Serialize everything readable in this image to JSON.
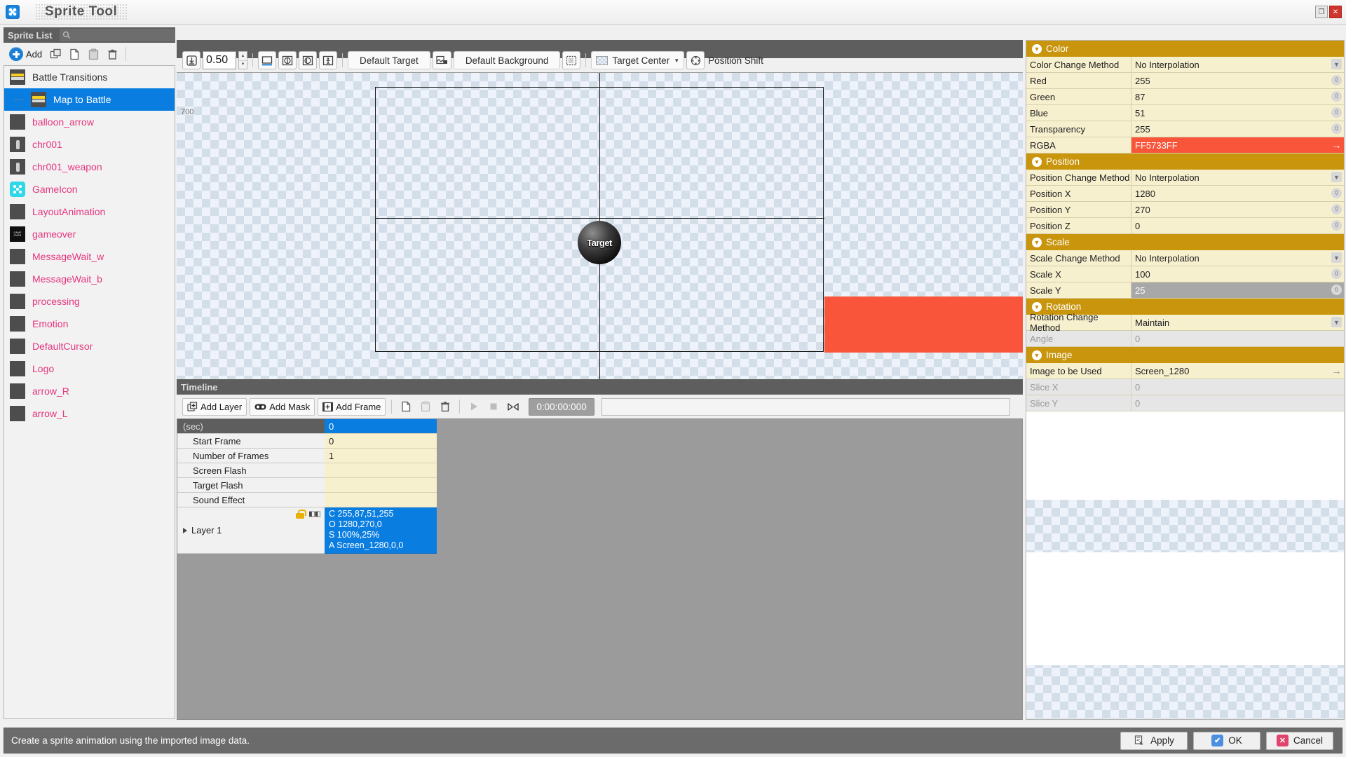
{
  "window": {
    "title": "Sprite Tool",
    "app_icon": "dice-icon",
    "restore_label": "❐",
    "close_label": "✕"
  },
  "sprite_panel": {
    "header": "Sprite List",
    "search_placeholder": "",
    "toolbar": {
      "add_label": "Add",
      "icons": [
        "duplicate-icon",
        "copy-icon",
        "paste-icon",
        "delete-icon"
      ]
    },
    "items": [
      {
        "label": "Battle Transitions",
        "type": "root",
        "thumb": "bar",
        "selected": false
      },
      {
        "label": "Map to Battle",
        "type": "child",
        "thumb": "bar",
        "selected": true
      },
      {
        "label": "balloon_arrow",
        "type": "item",
        "thumb": "plain",
        "selected": false
      },
      {
        "label": "chr001",
        "type": "item",
        "thumb": "chr",
        "selected": false
      },
      {
        "label": "chr001_weapon",
        "type": "item",
        "thumb": "chr",
        "selected": false
      },
      {
        "label": "GameIcon",
        "type": "item",
        "thumb": "icon",
        "selected": false
      },
      {
        "label": "LayoutAnimation",
        "type": "item",
        "thumb": "plain",
        "selected": false
      },
      {
        "label": "gameover",
        "type": "item",
        "thumb": "go",
        "selected": false
      },
      {
        "label": "MessageWait_w",
        "type": "item",
        "thumb": "plain",
        "selected": false
      },
      {
        "label": "MessageWait_b",
        "type": "item",
        "thumb": "plain",
        "selected": false
      },
      {
        "label": "processing",
        "type": "item",
        "thumb": "plain",
        "selected": false
      },
      {
        "label": "Emotion",
        "type": "item",
        "thumb": "plain",
        "selected": false
      },
      {
        "label": "DefaultCursor",
        "type": "item",
        "thumb": "plain",
        "selected": false
      },
      {
        "label": "Logo",
        "type": "item",
        "thumb": "plain",
        "selected": false
      },
      {
        "label": "arrow_R",
        "type": "item",
        "thumb": "plain",
        "selected": false
      },
      {
        "label": "arrow_L",
        "type": "item",
        "thumb": "plain",
        "selected": false
      }
    ]
  },
  "canvas_toolbar": {
    "zoom_value": "0.50",
    "fit_icon": "fit-to-screen-icon",
    "view_icons": [
      "screen-frame-icon",
      "safe-area-a-icon",
      "safe-area-b-icon",
      "character-scale-icon"
    ],
    "default_target_label": "Default Target",
    "target_image_icon": "target-image-icon",
    "default_background_label": "Default Background",
    "background_icon": "background-select-icon",
    "anchor_combo_label": "Target Center",
    "position_shift_label": "Position Shift",
    "position_shift_icon": "position-shift-icon"
  },
  "canvas": {
    "corner_text": "700",
    "target_label": "Target"
  },
  "timeline": {
    "header": "Timeline",
    "add_layer_label": "Add Layer",
    "add_mask_label": "Add Mask",
    "add_frame_label": "Add Frame",
    "copy_icon": "copy-frame-icon",
    "paste_icon": "paste-frame-icon",
    "delete_icon": "delete-frame-icon",
    "play_icon": "play-icon",
    "stop_icon": "stop-icon",
    "loop_icon": "loop-icon",
    "time_display": "0:00:00:000",
    "column_header": "(sec)",
    "column_value": "0",
    "rows": [
      {
        "label": "Start Frame",
        "value": "0"
      },
      {
        "label": "Number of Frames",
        "value": "1"
      },
      {
        "label": "Screen Flash",
        "value": ""
      },
      {
        "label": "Target Flash",
        "value": ""
      },
      {
        "label": "Sound Effect",
        "value": ""
      }
    ],
    "layer": {
      "name": "Layer 1",
      "lock_icon": "unlock-icon",
      "visibility_icon": "eye-icon",
      "expand_icon": "expand-triangle-icon",
      "keyframe_lines": [
        "C 255,87,51,255",
        "O 1280,270,0",
        "S 100%,25%",
        "A Screen_1280,0,0"
      ]
    }
  },
  "properties": {
    "groups": [
      {
        "title": "Color",
        "rows": [
          {
            "key": "Color Change Method",
            "value": "No Interpolation",
            "ctl": "dropdown",
            "state": "normal"
          },
          {
            "key": "Red",
            "value": "255",
            "ctl": "spinner",
            "state": "normal"
          },
          {
            "key": "Green",
            "value": "87",
            "ctl": "spinner",
            "state": "normal"
          },
          {
            "key": "Blue",
            "value": "51",
            "ctl": "spinner",
            "state": "normal"
          },
          {
            "key": "Transparency",
            "value": "255",
            "ctl": "spinner",
            "state": "normal"
          },
          {
            "key": "RGBA",
            "value": "FF5733FF",
            "ctl": "arrow",
            "state": "red"
          }
        ]
      },
      {
        "title": "Position",
        "rows": [
          {
            "key": "Position Change Method",
            "value": "No Interpolation",
            "ctl": "dropdown",
            "state": "normal"
          },
          {
            "key": "Position X",
            "value": "1280",
            "ctl": "spinner",
            "state": "normal"
          },
          {
            "key": "Position Y",
            "value": "270",
            "ctl": "spinner",
            "state": "normal"
          },
          {
            "key": "Position Z",
            "value": "0",
            "ctl": "spinner",
            "state": "normal"
          }
        ]
      },
      {
        "title": "Scale",
        "rows": [
          {
            "key": "Scale Change Method",
            "value": "No Interpolation",
            "ctl": "dropdown",
            "state": "normal"
          },
          {
            "key": "Scale X",
            "value": "100",
            "ctl": "spinner",
            "state": "normal"
          },
          {
            "key": "Scale Y",
            "value": "25",
            "ctl": "spinner",
            "state": "selected"
          }
        ]
      },
      {
        "title": "Rotation",
        "rows": [
          {
            "key": "Rotation Change Method",
            "value": "Maintain",
            "ctl": "dropdown",
            "state": "normal"
          },
          {
            "key": "Angle",
            "value": "0",
            "ctl": "none",
            "state": "disabled"
          }
        ]
      },
      {
        "title": "Image",
        "rows": [
          {
            "key": "Image to be Used",
            "value": "Screen_1280",
            "ctl": "arrow",
            "state": "normal"
          },
          {
            "key": "Slice X",
            "value": "0",
            "ctl": "none",
            "state": "disabled"
          },
          {
            "key": "Slice Y",
            "value": "0",
            "ctl": "none",
            "state": "disabled"
          }
        ]
      }
    ]
  },
  "statusbar": {
    "message": "Create a sprite animation using the imported image data.",
    "buttons": [
      {
        "label": "Apply",
        "icon": "apply-icon"
      },
      {
        "label": "OK",
        "icon": "check-icon"
      },
      {
        "label": "Cancel",
        "icon": "x-icon"
      }
    ]
  },
  "colors": {
    "accent_blue": "#0a7de0",
    "group_gold": "#c8950c",
    "field_cream": "#f7f0cf",
    "rgba_red": "#f9553a",
    "sprite_pink": "#e6357f"
  }
}
